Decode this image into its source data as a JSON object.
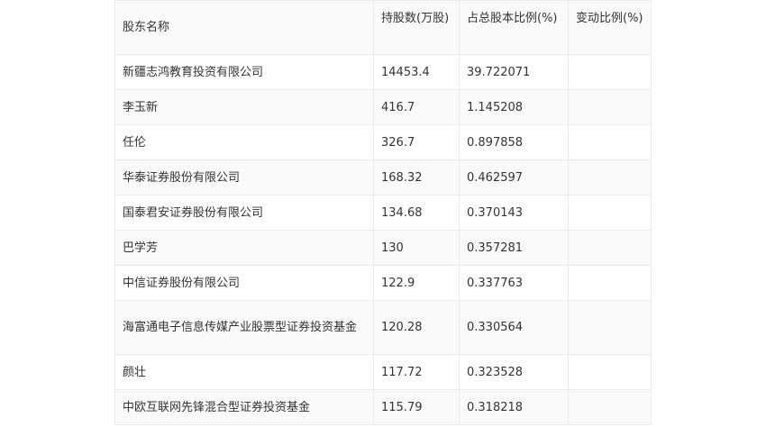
{
  "table": {
    "headers": [
      "股东名称",
      "持股数(万股)",
      "占总股本比例(%)",
      "变动比例(%)"
    ],
    "rows": [
      {
        "name": "新疆志鸿教育投资有限公司",
        "shares": "14453.4",
        "ratio": "39.722071",
        "change": ""
      },
      {
        "name": "李玉新",
        "shares": "416.7",
        "ratio": "1.145208",
        "change": ""
      },
      {
        "name": "任伦",
        "shares": "326.7",
        "ratio": "0.897858",
        "change": ""
      },
      {
        "name": "华泰证券股份有限公司",
        "shares": "168.32",
        "ratio": "0.462597",
        "change": ""
      },
      {
        "name": "国泰君安证券股份有限公司",
        "shares": "134.68",
        "ratio": "0.370143",
        "change": ""
      },
      {
        "name": "巴学芳",
        "shares": "130",
        "ratio": "0.357281",
        "change": ""
      },
      {
        "name": "中信证券股份有限公司",
        "shares": "122.9",
        "ratio": "0.337763",
        "change": ""
      },
      {
        "name": "海富通电子信息传媒产业股票型证券投资基金",
        "shares": "120.28",
        "ratio": "0.330564",
        "change": ""
      },
      {
        "name": "颜壮",
        "shares": "117.72",
        "ratio": "0.323528",
        "change": ""
      },
      {
        "name": "中欧互联网先锋混合型证券投资基金",
        "shares": "115.79",
        "ratio": "0.318218",
        "change": ""
      }
    ]
  }
}
